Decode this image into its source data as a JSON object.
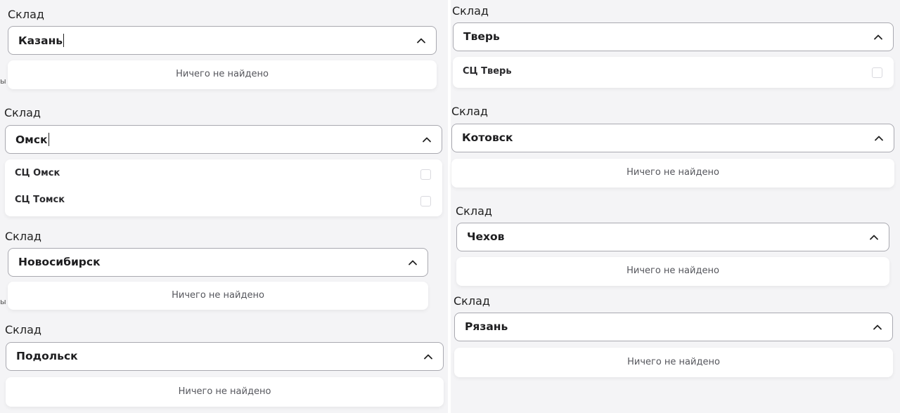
{
  "field_label": "Склад",
  "empty_text": "Ничего не найдено",
  "edge_glyph": "ы",
  "blocks": [
    {
      "value": "Казань",
      "typing": true,
      "options": []
    },
    {
      "value": "Омск",
      "typing": true,
      "options": [
        "СЦ Омск",
        "СЦ Томск"
      ]
    },
    {
      "value": "Новосибирск",
      "typing": false,
      "options": []
    },
    {
      "value": "Подольск",
      "typing": false,
      "options": []
    },
    {
      "value": "Тверь",
      "typing": false,
      "options": [
        "СЦ Тверь"
      ]
    },
    {
      "value": "Котовск",
      "typing": false,
      "options": []
    },
    {
      "value": "Чехов",
      "typing": false,
      "options": []
    },
    {
      "value": "Рязань",
      "typing": false,
      "options": []
    }
  ],
  "icons": {
    "chevron": "chevron-up-icon"
  }
}
